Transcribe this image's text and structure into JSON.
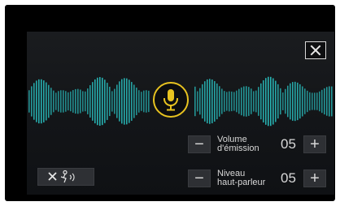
{
  "panel": {
    "close_icon": "close-icon",
    "mic_icon": "microphone-icon",
    "mic_color": "#e8c320",
    "wave_color": "#28b6b6"
  },
  "controls": {
    "transmit_volume": {
      "label_line1": "Volume",
      "label_line2": "d'émission",
      "value": "05",
      "minus": "−",
      "plus": "+"
    },
    "speaker_level": {
      "label_line1": "Niveau",
      "label_line2": "haut-parleur",
      "value": "05",
      "minus": "−",
      "plus": "+"
    }
  },
  "mute_button": {
    "icon": "mute-speaking-icon"
  }
}
